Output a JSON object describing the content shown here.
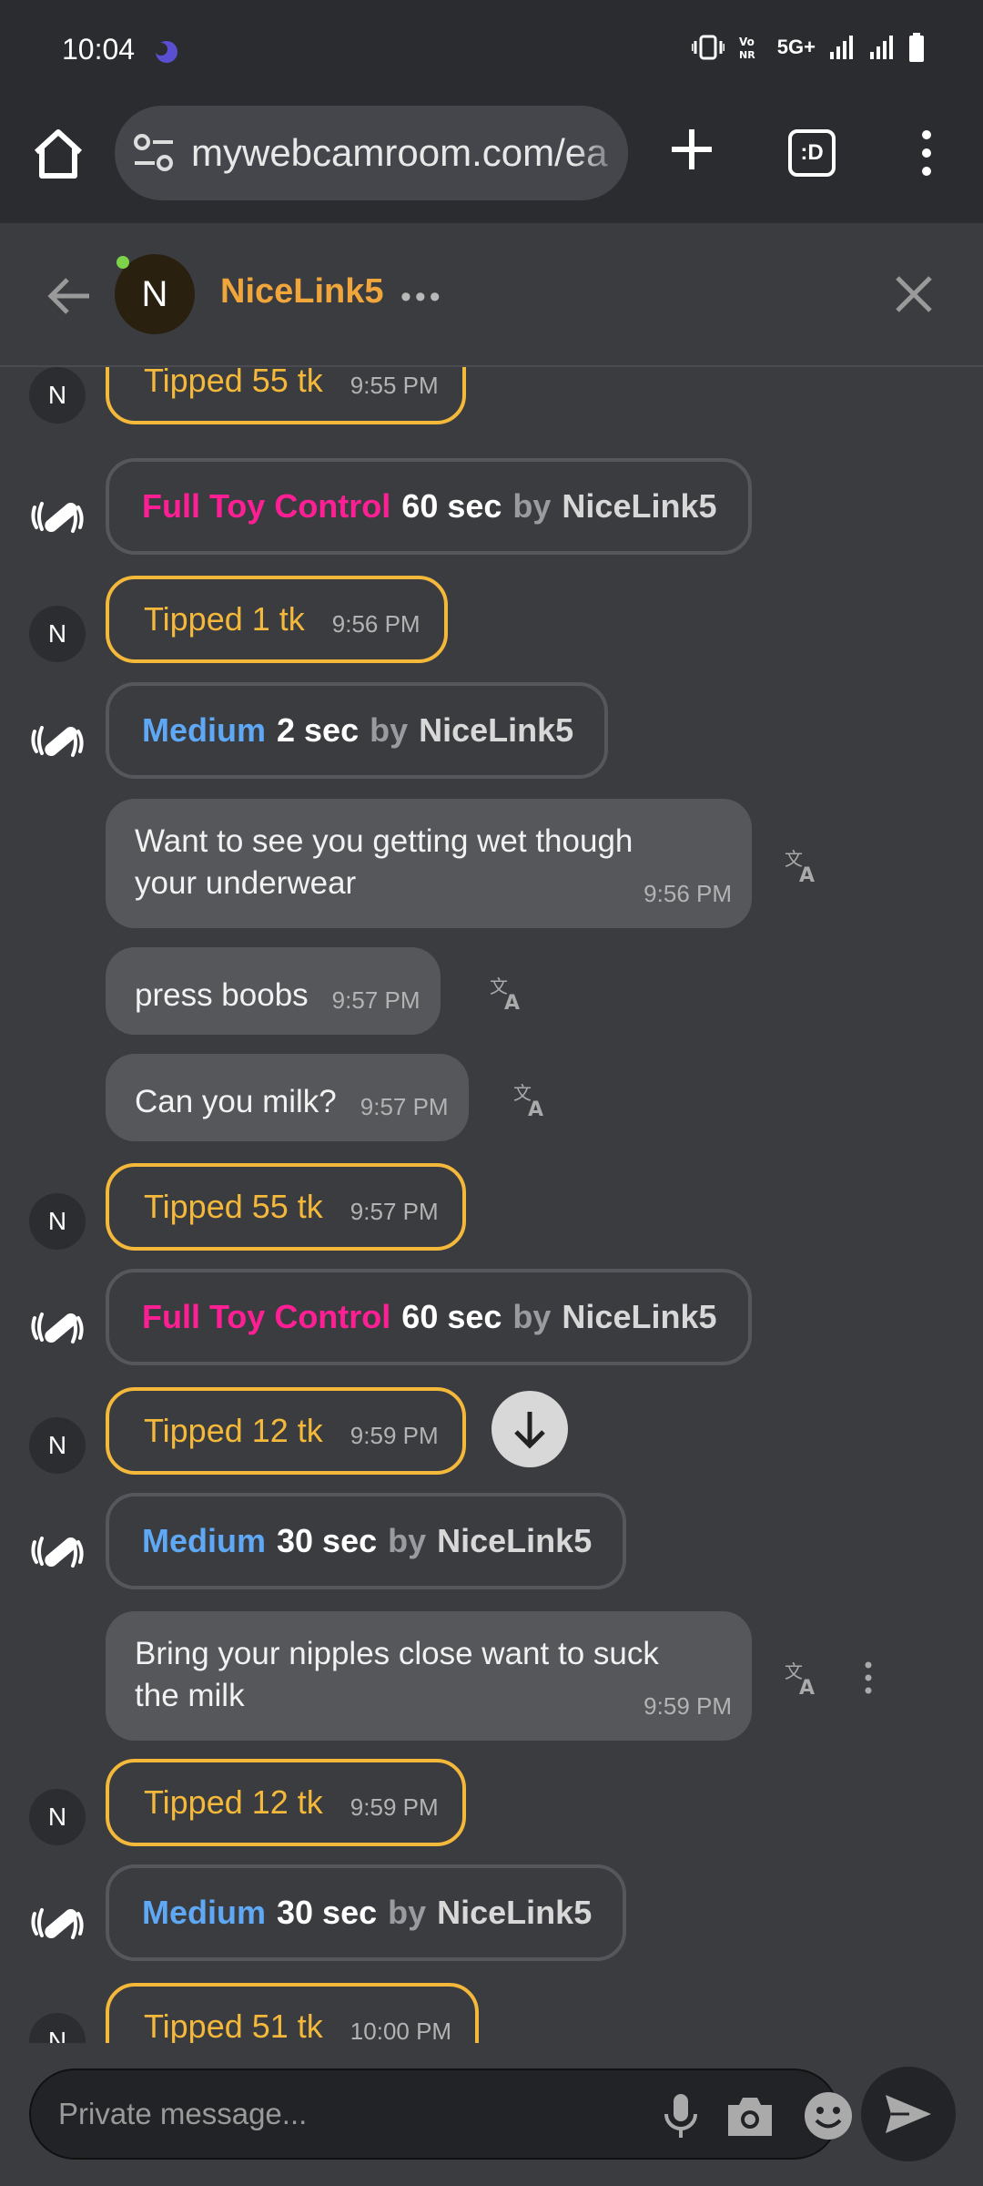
{
  "status_bar": {
    "time": "10:04",
    "network": "5G+"
  },
  "browser": {
    "url": "mywebcamroom.com/ea",
    "tabs_label": ":D"
  },
  "chat_header": {
    "avatar_letter": "N",
    "username": "NiceLink5",
    "more": "•••",
    "online_color": "#7bd34a"
  },
  "messages": [
    {
      "type": "tip",
      "text": "Tipped 55 tk",
      "time": "9:55 PM"
    },
    {
      "type": "toy",
      "level": "Full Toy Control",
      "duration": "60 sec",
      "by": "by",
      "user": "NiceLink5"
    },
    {
      "type": "tip",
      "text": "Tipped 1 tk",
      "time": "9:56 PM"
    },
    {
      "type": "toy",
      "level": "Medium",
      "duration": "2 sec",
      "by": "by",
      "user": "NiceLink5"
    },
    {
      "type": "text",
      "lines": [
        "Want to see you getting wet though",
        "your underwear"
      ],
      "time": "9:56 PM"
    },
    {
      "type": "text",
      "text": "press boobs",
      "time": "9:57 PM"
    },
    {
      "type": "text",
      "text": "Can you milk?",
      "time": "9:57 PM"
    },
    {
      "type": "tip",
      "text": "Tipped 55 tk",
      "time": "9:57 PM"
    },
    {
      "type": "toy",
      "level": "Full Toy Control",
      "duration": "60 sec",
      "by": "by",
      "user": "NiceLink5"
    },
    {
      "type": "tip",
      "text": "Tipped 12 tk",
      "time": "9:59 PM"
    },
    {
      "type": "toy",
      "level": "Medium",
      "duration": "30 sec",
      "by": "by",
      "user": "NiceLink5"
    },
    {
      "type": "text",
      "lines": [
        "Bring your nipples close want to suck",
        "the milk"
      ],
      "time": "9:59 PM"
    },
    {
      "type": "tip",
      "text": "Tipped 12 tk",
      "time": "9:59 PM"
    },
    {
      "type": "toy",
      "level": "Medium",
      "duration": "30 sec",
      "by": "by",
      "user": "NiceLink5"
    },
    {
      "type": "tip",
      "text": "Tipped 51 tk",
      "time": "10:00 PM"
    }
  ],
  "avatar_letter": "N",
  "composer": {
    "placeholder": "Private message..."
  },
  "colors": {
    "tip": "#f4b83a",
    "full_toy_control": "#ff1f95",
    "medium": "#5ea8f5",
    "username": "#f0a63a"
  }
}
